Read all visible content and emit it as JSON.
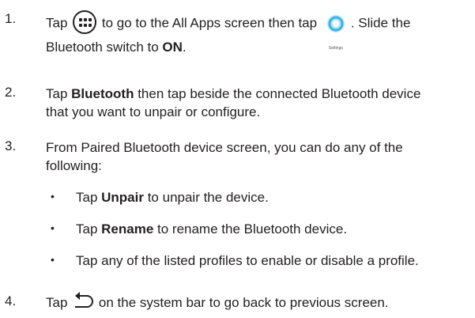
{
  "steps": [
    {
      "num": "1.",
      "l1a": "Tap",
      "l1b": "to go to the All Apps screen then tap",
      "l1c": ". Slide the",
      "l2a": "Bluetooth switch to ",
      "l2b": "ON",
      "l2c": ".",
      "settings_label": "Settings"
    },
    {
      "num": "2.",
      "l1a": "Tap ",
      "l1b": "Bluetooth",
      "l1c": " then tap  beside the connected Bluetooth device",
      "l2": "that you want to unpair or configure."
    },
    {
      "num": "3.",
      "l1": "From Paired Bluetooth device screen, you can do any of the",
      "l2": "following:"
    },
    {
      "num": "4.",
      "l1a": "Tap",
      "l1b": "on the system bar to go back to previous screen."
    }
  ],
  "bullets": [
    {
      "mark": "•",
      "pre": "Tap ",
      "bold": "Unpair",
      "post": " to unpair the device."
    },
    {
      "mark": "•",
      "pre": "Tap ",
      "bold": "Rename",
      "post": " to rename the Bluetooth device."
    },
    {
      "mark": "•",
      "pre": "",
      "bold": "",
      "post": "Tap any of the listed profiles to enable or disable a profile."
    }
  ],
  "icons": {
    "all_apps": "all-apps-icon",
    "settings": "settings-gear-icon",
    "back": "back-arrow-icon"
  },
  "colors": {
    "text": "#231f20",
    "settings_gear": "#3ab4e6"
  }
}
